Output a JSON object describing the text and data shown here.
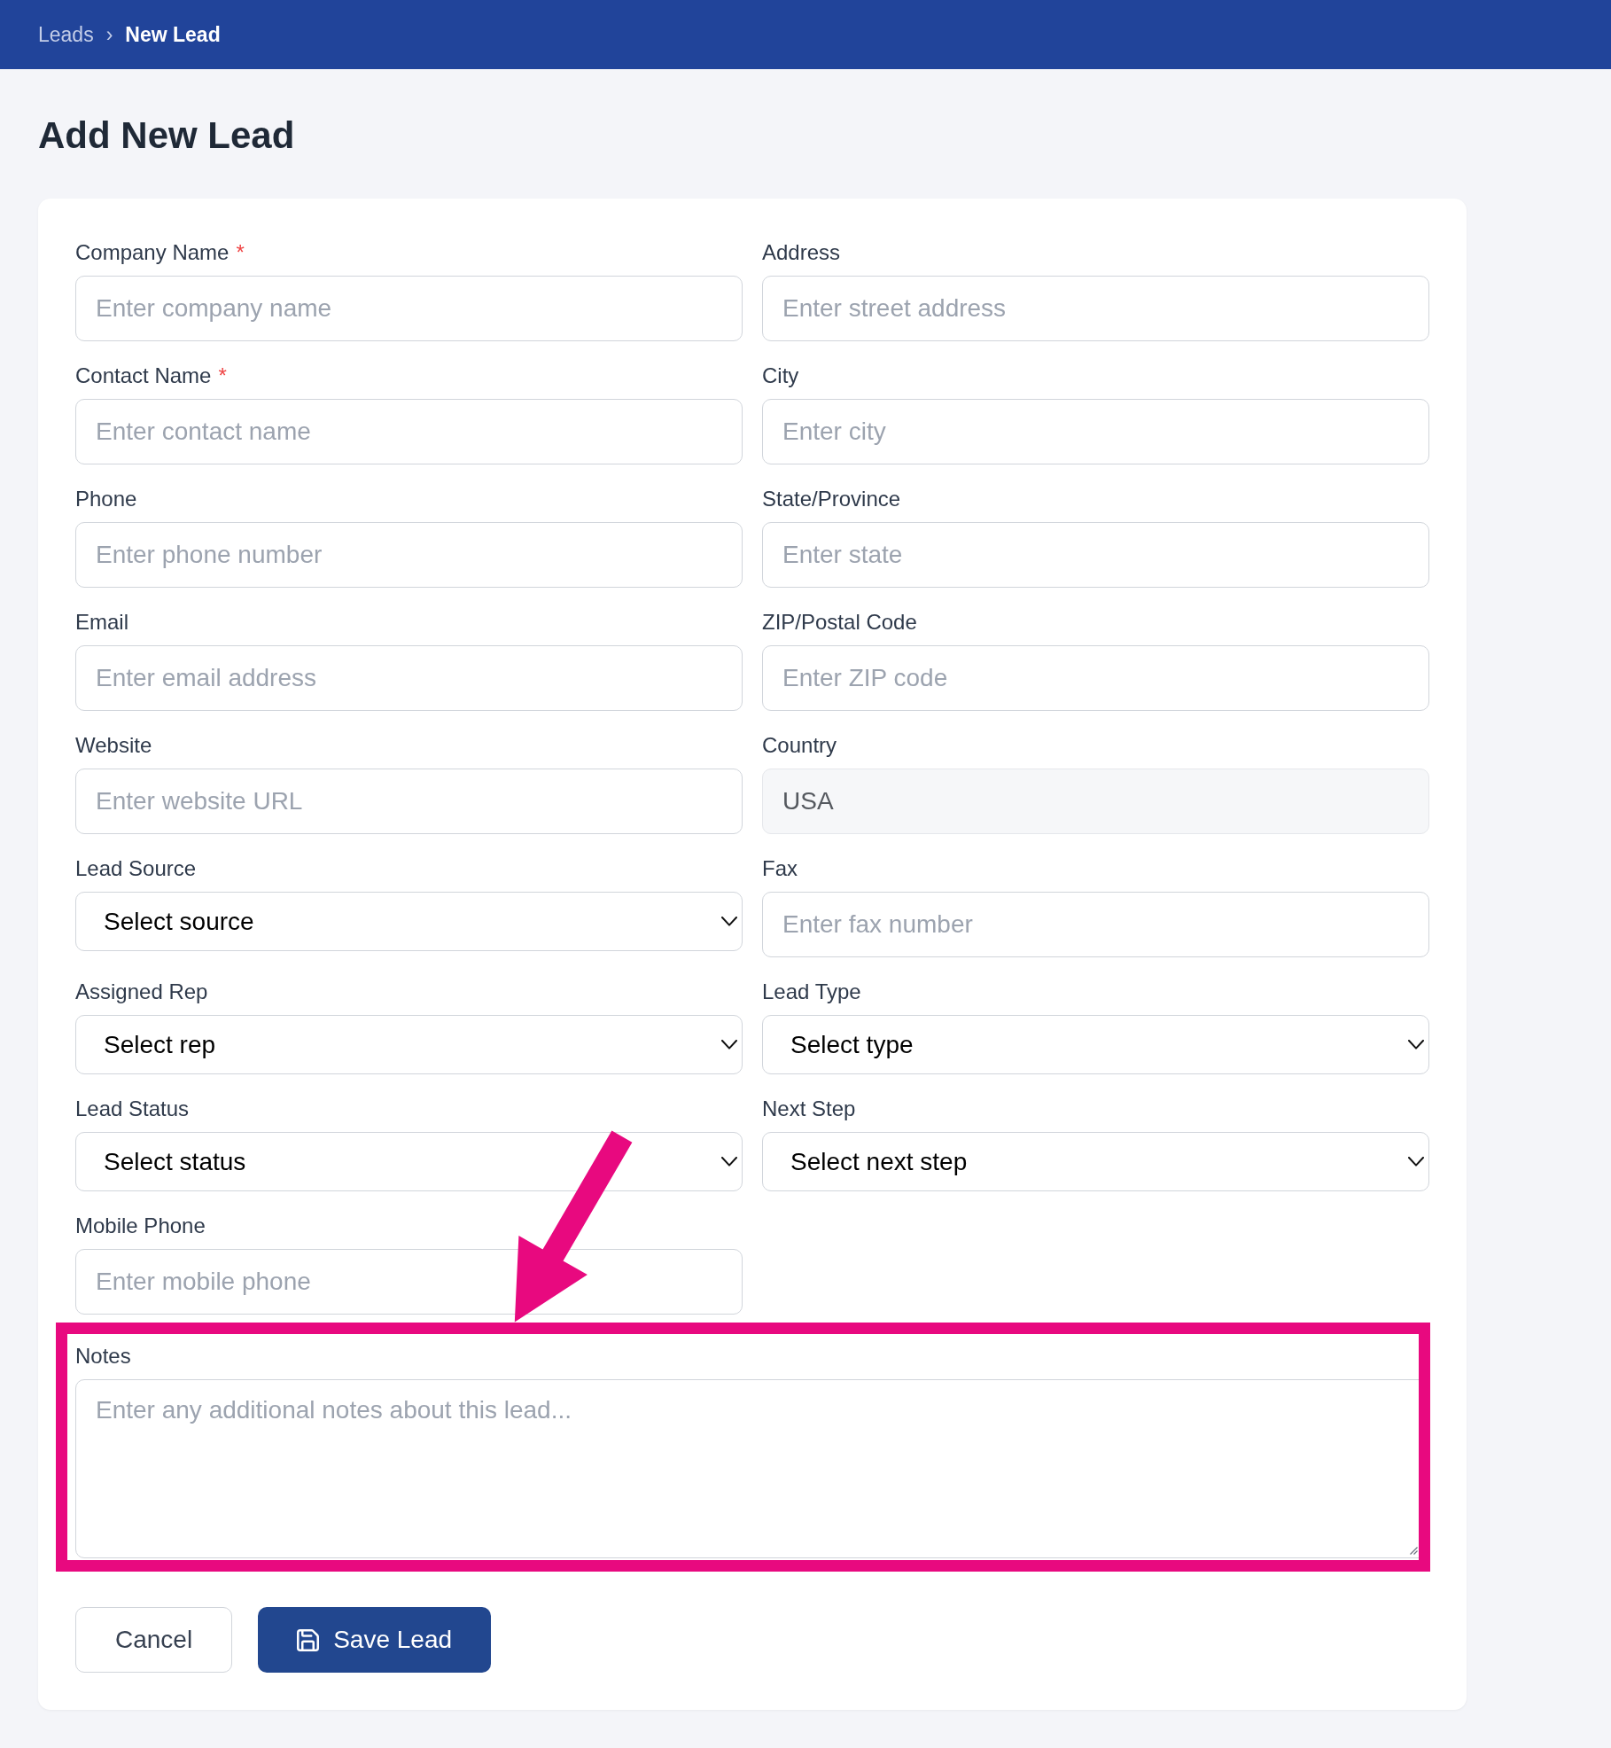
{
  "breadcrumb": {
    "separator": "›",
    "items": [
      {
        "label": "Leads",
        "current": false
      },
      {
        "label": "New Lead",
        "current": true
      }
    ]
  },
  "page_title": "Add New Lead",
  "form": {
    "required_mark": "*",
    "fields": [
      {
        "kind": "text",
        "label": "Company Name",
        "required": true,
        "disabled": false,
        "placeholder": "Enter company name"
      },
      {
        "kind": "text",
        "label": "Address",
        "required": false,
        "disabled": false,
        "placeholder": "Enter street address"
      },
      {
        "kind": "text",
        "label": "Contact Name",
        "required": true,
        "disabled": false,
        "placeholder": "Enter contact name"
      },
      {
        "kind": "text",
        "label": "City",
        "required": false,
        "disabled": false,
        "placeholder": "Enter city"
      },
      {
        "kind": "text",
        "label": "Phone",
        "required": false,
        "disabled": false,
        "placeholder": "Enter phone number"
      },
      {
        "kind": "text",
        "label": "State/Province",
        "required": false,
        "disabled": false,
        "placeholder": "Enter state"
      },
      {
        "kind": "text",
        "label": "Email",
        "required": false,
        "disabled": false,
        "placeholder": "Enter email address"
      },
      {
        "kind": "text",
        "label": "ZIP/Postal Code",
        "required": false,
        "disabled": false,
        "placeholder": "Enter ZIP code"
      },
      {
        "kind": "text",
        "label": "Website",
        "required": false,
        "disabled": false,
        "placeholder": "Enter website URL"
      },
      {
        "kind": "text",
        "label": "Country",
        "required": false,
        "disabled": true,
        "value": "USA"
      },
      {
        "kind": "select",
        "label": "Lead Source",
        "required": false,
        "disabled": false,
        "value": "Select source"
      },
      {
        "kind": "text",
        "label": "Fax",
        "required": false,
        "disabled": false,
        "placeholder": "Enter fax number"
      },
      {
        "kind": "select",
        "label": "Assigned Rep",
        "required": false,
        "disabled": false,
        "value": "Select rep"
      },
      {
        "kind": "select",
        "label": "Lead Type",
        "required": false,
        "disabled": false,
        "value": "Select type"
      },
      {
        "kind": "select",
        "label": "Lead Status",
        "required": false,
        "disabled": false,
        "value": "Select status"
      },
      {
        "kind": "select",
        "label": "Next Step",
        "required": false,
        "disabled": false,
        "value": "Select next step"
      },
      {
        "kind": "text",
        "label": "Mobile Phone",
        "required": false,
        "disabled": false,
        "placeholder": "Enter mobile phone"
      }
    ],
    "notes": {
      "label": "Notes",
      "placeholder": "Enter any additional notes about this lead..."
    },
    "actions": [
      {
        "kind": "secondary",
        "label": "Cancel"
      },
      {
        "kind": "primary",
        "label": "Save Lead"
      }
    ]
  }
}
